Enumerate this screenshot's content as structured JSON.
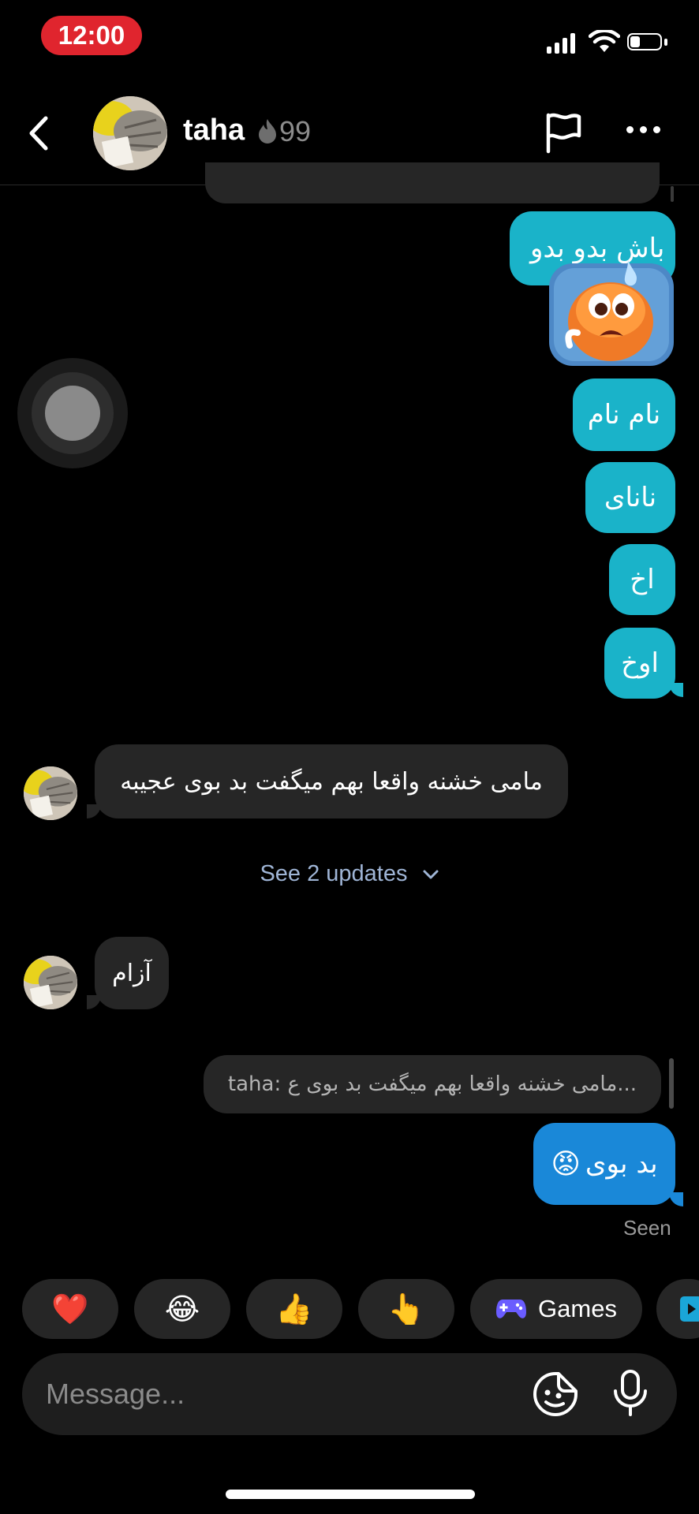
{
  "status_bar": {
    "time": "12:00"
  },
  "header": {
    "name": "taha",
    "streak_count": "99"
  },
  "messages_sent": [
    {
      "text": "باش بدو بدو"
    },
    {
      "text": "نام نام"
    },
    {
      "text": "نانای"
    },
    {
      "text": "اخ"
    },
    {
      "text": "اوخ"
    }
  ],
  "received": [
    {
      "text": "مامی خشنه واقعا بهم میگفت بد بوی عجیبه"
    },
    {
      "text": "آزام"
    }
  ],
  "updates_link": {
    "label": "See 2 updates"
  },
  "reply": {
    "quote": "taha: مامی خشنه واقعا بهم میگفت بد بوی ع...",
    "text": "بد بوی",
    "emoji": "😡"
  },
  "seen_label": "Seen",
  "quick_reactions": [
    {
      "emoji": "❤️"
    },
    {
      "emoji": "😂"
    },
    {
      "emoji": "👍"
    },
    {
      "emoji": "👆"
    }
  ],
  "games_label": "Games",
  "composer": {
    "placeholder": "Message..."
  },
  "colors": {
    "sent_bubble": "#1ab3c9",
    "reply_bubble": "#1a88d8",
    "received_bubble": "#262626",
    "time_pill": "#e0252e",
    "link": "#9fb5d6"
  }
}
